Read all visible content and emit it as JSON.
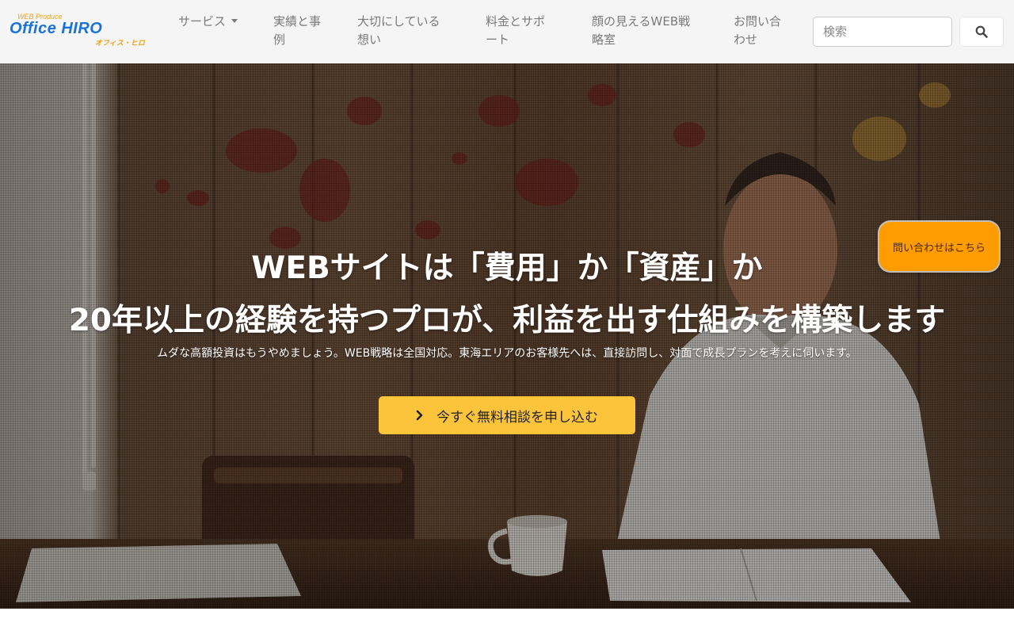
{
  "brand": {
    "tagline": "WEB Produce",
    "word1": "Office",
    "word2": "HIRO",
    "kana": "オフィス・ヒロ"
  },
  "nav": {
    "services_line1": "サービス",
    "works_line1": "実績と事",
    "works_line2": "例",
    "values_line1": "大切にしている",
    "values_line2": "想い",
    "pricing_line1": "料金とサポ",
    "pricing_line2": "ート",
    "strategy_line1": "顔の見えるWEB戦",
    "strategy_line2": "略室",
    "contact_line1": "お問い合",
    "contact_line2": "わせ"
  },
  "search": {
    "placeholder": "検索",
    "icon": "search-icon"
  },
  "hero": {
    "title_line1": "WEBサイトは「費用」か「資産」か",
    "title_line2": "20年以上の経験を持つプロが、利益を出す仕組みを構築します",
    "subtitle": "ムダな高額投資はもうやめましょう。WEB戦略は全国対応。東海エリアのお客様先へは、直接訪問し、対面で成長プランを考えに伺います。",
    "cta_label": "今すぐ無料相談を申し込む",
    "cta_icon": "chevron-right-icon"
  },
  "floating_contact": {
    "label": "問い合わせはこちら"
  },
  "colors": {
    "nav_bg": "#f5f5f5",
    "nav_text": "#7a7a7a",
    "brand_blue": "#1a73d9",
    "brand_orange": "#e8a317",
    "cta_bg": "#fcc43a",
    "float_bg": "#ff9c00"
  }
}
